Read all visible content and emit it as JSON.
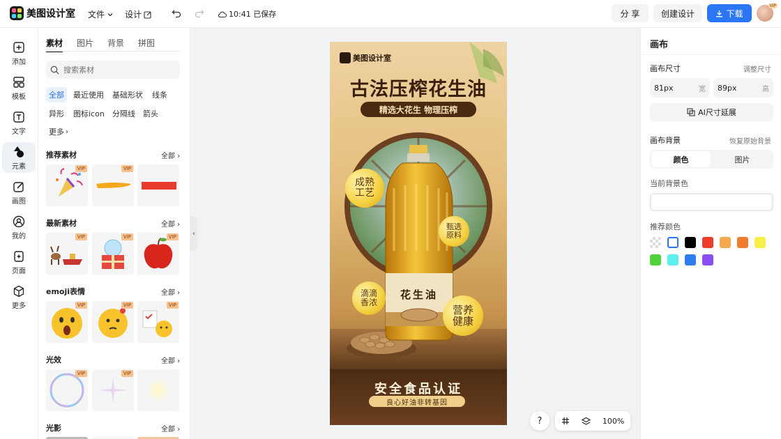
{
  "app": {
    "name": "美图设计室",
    "save_status": "10:41 已保存"
  },
  "topbar": {
    "file_label": "文件",
    "design_label": "设计",
    "share_label": "分 享",
    "create_label": "创建设计",
    "download_label": "下载",
    "avatar_badge": "VIP"
  },
  "leftnav": {
    "items": [
      {
        "label": "添加",
        "icon": "plus-square-icon"
      },
      {
        "label": "模板",
        "icon": "template-icon"
      },
      {
        "label": "文字",
        "icon": "text-icon"
      },
      {
        "label": "元素",
        "icon": "shapes-icon"
      },
      {
        "label": "画图",
        "icon": "pencil-icon"
      },
      {
        "label": "我的",
        "icon": "user-icon"
      },
      {
        "label": "页面",
        "icon": "pages-icon"
      },
      {
        "label": "更多",
        "icon": "cube-icon"
      }
    ],
    "active_index": 3
  },
  "panel": {
    "tabs": [
      "素材",
      "图片",
      "背景",
      "拼图"
    ],
    "active_tab": 0,
    "search_placeholder": "搜索素材",
    "chips": [
      "全部",
      "最近使用",
      "基础形状",
      "线条",
      "异形",
      "图标icon",
      "分隔线",
      "箭头",
      "更多"
    ],
    "sections": [
      {
        "title": "推荐素材",
        "all": "全部"
      },
      {
        "title": "最新素材",
        "all": "全部"
      },
      {
        "title": "emoji表情",
        "all": "全部"
      },
      {
        "title": "光效",
        "all": "全部"
      },
      {
        "title": "光影",
        "all": "全部"
      }
    ],
    "vip_label": "VIP"
  },
  "poster": {
    "brand": "美图设计室",
    "headline": "古法压榨花生油",
    "subline": "精选大花生 物理压榨",
    "badges": [
      "成熟工艺",
      "甄选原料",
      "滴滴香浓",
      "营养健康"
    ],
    "bottle_label": "花生油",
    "footer_title": "安全食品认证",
    "footer_sub": "良心好油非转基因"
  },
  "rightpanel": {
    "title": "画布",
    "size_label": "画布尺寸",
    "resize_link": "调整尺寸",
    "width_value": "81px",
    "width_unit": "宽",
    "height_value": "89px",
    "height_unit": "高",
    "ai_extend_label": "AI尺寸延展",
    "bg_label": "画布背景",
    "restore_link": "恢复原始背景",
    "bg_tabs": [
      "颜色",
      "图片"
    ],
    "current_bg_label": "当前背景色",
    "recommend_label": "推荐颜色",
    "colors": [
      "transparent",
      "#ffffff",
      "#000000",
      "#ee3b2b",
      "#f7a94b",
      "#f07b2c",
      "#f7f04a",
      "#52d13c",
      "#5ef0ee",
      "#2f7bf0",
      "#8a4ff0"
    ]
  },
  "canvas_controls": {
    "help": "?",
    "zoom": "100%"
  }
}
